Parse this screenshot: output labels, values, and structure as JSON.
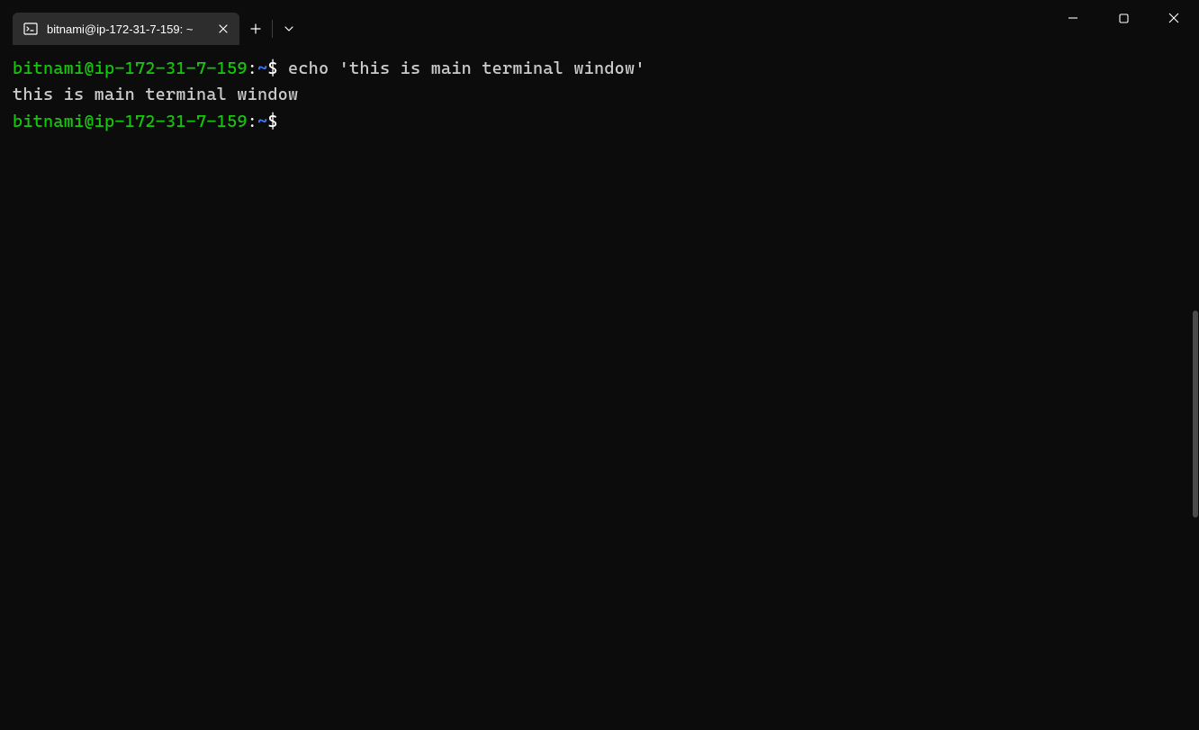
{
  "tab": {
    "title": "bitnami@ip-172-31-7-159: ~"
  },
  "terminal": {
    "lines": [
      {
        "user": "bitnami@ip-172-31-7-159",
        "colon": ":",
        "path": "~",
        "dollar": "$",
        "command": " echo 'this is main terminal window'"
      }
    ],
    "output1": "this is main terminal window",
    "prompt2": {
      "user": "bitnami@ip-172-31-7-159",
      "colon": ":",
      "path": "~",
      "dollar": "$",
      "command": ""
    }
  }
}
